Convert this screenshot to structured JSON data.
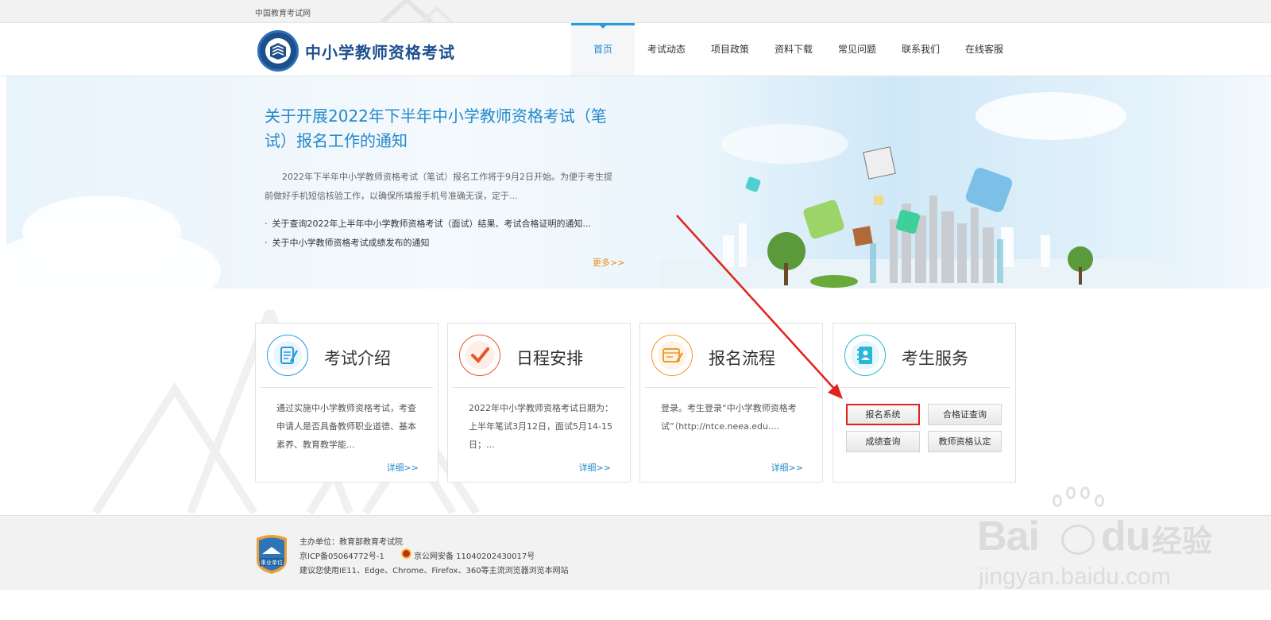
{
  "topbar": {
    "site_name": "中国教育考试网"
  },
  "header": {
    "logo_title": "中小学教师资格考试",
    "nav": [
      {
        "label": "首页",
        "active": true
      },
      {
        "label": "考试动态"
      },
      {
        "label": "项目政策"
      },
      {
        "label": "资料下载"
      },
      {
        "label": "常见问题"
      },
      {
        "label": "联系我们"
      },
      {
        "label": "在线客服"
      }
    ]
  },
  "banner": {
    "title": "关于开展2022年下半年中小学教师资格考试（笔试）报名工作的通知",
    "summary": "2022年下半年中小学教师资格考试（笔试）报名工作将于9月2日开始。为便于考生提前做好手机短信核验工作，以确保所填报手机号准确无误，定于...",
    "news": [
      "关于查询2022年上半年中小学教师资格考试（面试）结果、考试合格证明的通知...",
      "关于中小学教师资格考试成绩发布的通知"
    ],
    "more": "更多>>"
  },
  "cards": [
    {
      "title": "考试介绍",
      "desc": "通过实施中小学教师资格考试，考查申请人是否具备教师职业道德、基本素养、教育教学能...",
      "detail": "详细>>",
      "icon": "document-edit-icon",
      "color": "#2a9ae0"
    },
    {
      "title": "日程安排",
      "desc": "2022年中小学教师资格考试日期为：上半年笔试3月12日，面试5月14-15日；...",
      "detail": "详细>>",
      "icon": "checkmark-icon",
      "color": "#e8552a"
    },
    {
      "title": "报名流程",
      "desc": "登录。考生登录“中小学教师资格考试”（http://ntce.neea.edu....",
      "detail": "详细>>",
      "icon": "form-pencil-icon",
      "color": "#f09a2a"
    },
    {
      "title": "考生服务",
      "icon": "contact-book-icon",
      "color": "#2ab6d8"
    }
  ],
  "services": [
    {
      "label": "报名系统",
      "highlighted": true
    },
    {
      "label": "合格证查询"
    },
    {
      "label": "成绩查询"
    },
    {
      "label": "教师资格认定"
    }
  ],
  "footer": {
    "badge_text": "事业单位",
    "organizer": "主办单位：教育部教育考试院",
    "icp": "京ICP备05064772号-1",
    "police": "京公网安备 11040202430017号",
    "browser_tip": "建议您使用IE11、Edge、Chrome、Firefox、360等主流浏览器浏览本网站"
  },
  "watermark": {
    "main": "Bai",
    "du": "du",
    "cn": "经验",
    "sub": "jingyan.baidu.com"
  },
  "colors": {
    "accent": "#2a9ae0",
    "title_blue": "#1e4f8f",
    "more_orange": "#e88a1a",
    "highlight_red": "#e0231b",
    "arrow_red": "#e0231b"
  }
}
